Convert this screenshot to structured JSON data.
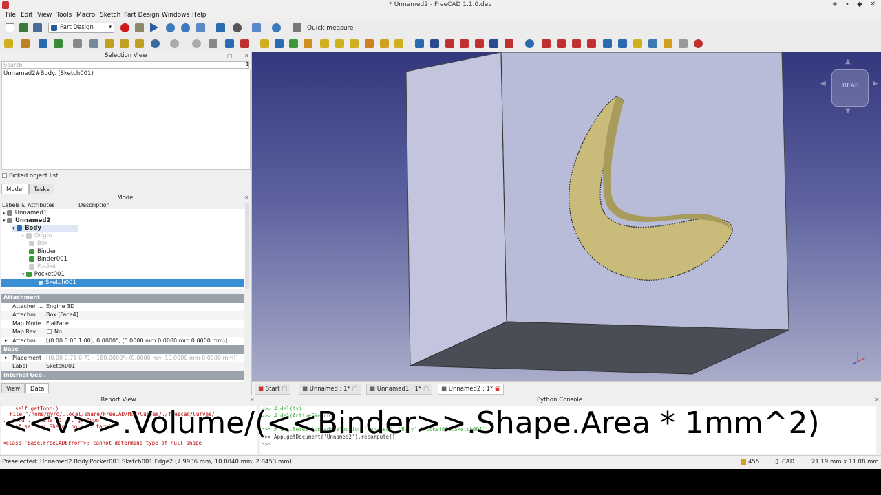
{
  "window": {
    "title": "* Unnamed2 - FreeCAD 1.1.0.dev"
  },
  "menu": [
    "File",
    "Edit",
    "View",
    "Tools",
    "Macro",
    "Sketch",
    "Part Design",
    "Windows",
    "Help"
  ],
  "toolbar": {
    "workbench": "Part Design",
    "quick_measure": "Quick measure"
  },
  "selection_view": {
    "title": "Selection View",
    "search_placeholder": "Search",
    "count": "1",
    "item": "Unnamed2#Body. (Sketch001)",
    "picked_label": "Picked object list"
  },
  "left_tabs": [
    "Model",
    "Tasks"
  ],
  "model": {
    "title": "Model",
    "col1": "Labels & Attributes",
    "col2": "Description",
    "items": [
      {
        "label": "Unnamed1"
      },
      {
        "label": "Unnamed2"
      },
      {
        "label": "Body"
      },
      {
        "label": "Origin"
      },
      {
        "label": "Box"
      },
      {
        "label": "Binder"
      },
      {
        "label": "Binder001"
      },
      {
        "label": "Pocket"
      },
      {
        "label": "Pocket001"
      },
      {
        "label": "Sketch001"
      }
    ]
  },
  "properties": {
    "sections": [
      "Attachment",
      "Base",
      "Internal Geo.."
    ],
    "rows": [
      {
        "k": "Attacher ...",
        "v": "Engine 3D"
      },
      {
        "k": "Attachm...",
        "v": "Box [Face4]"
      },
      {
        "k": "Map Mode",
        "v": "FlatFace"
      },
      {
        "k": "Map Rev...",
        "v": "No"
      },
      {
        "k": "Attachm...",
        "v": "[(0.00 0.00 1.00); 0.0000°; (0.0000 mm  0.0000 mm  0.0000 mm)]"
      },
      {
        "k": "Placement",
        "v": "[(0.00 0.71 0.71); 180.0000°; (0.0000 mm  10.0000 mm  0.0000 mm)]"
      },
      {
        "k": "Label",
        "v": "Sketch001"
      }
    ]
  },
  "prop_tabs": [
    "View",
    "Data"
  ],
  "navcube": {
    "face": "REAR"
  },
  "doc_tabs": [
    "Start",
    "Unnamed : 1*",
    "Unnamed1 : 1*",
    "Unnamed2 : 1*"
  ],
  "report_view": {
    "title": "Report View",
    "lines": [
      "self.getTopo()",
      "File \"/home/pyro/.local/share/FreeCAD/Mod/Curves/./freecad/Curves/",
      "...infd ... line 62 ... getTopo",
      "if sel..ss.Shape..po = ...face)",
      "<class 'Base.FreeCADError'>: cannot determine type of null shape"
    ]
  },
  "python_console": {
    "title": "Python Console",
    "lines": [
      ">>> # del(tv)",
      ">>> # del(ActiveSketch)",
      ">>> # Gui.Selection.addSelection('Unnamed2','Body','Pocket001.Sketch001')",
      ">>> App.getDocument('Unnamed2').recompute()",
      ">>> "
    ]
  },
  "overlay_text": "<<v>>.Volume/(<<Binder>>.Shape.Area * 1mm^2)",
  "status": {
    "preselected": "Preselected: Unnamed2.Body.Pocket001.Sketch001.Edge2 (7.9936 mm, 10.0040 mm, 2.8453 mm)",
    "memory": "455",
    "nav": "CAD",
    "dims": "21.19 mm x 11.08 mm"
  },
  "colors": {
    "selection": "#3a8fd4",
    "part_face": "#c9bc7a",
    "box_face": "#b9bcd9",
    "viewport_top": "#33387e"
  }
}
